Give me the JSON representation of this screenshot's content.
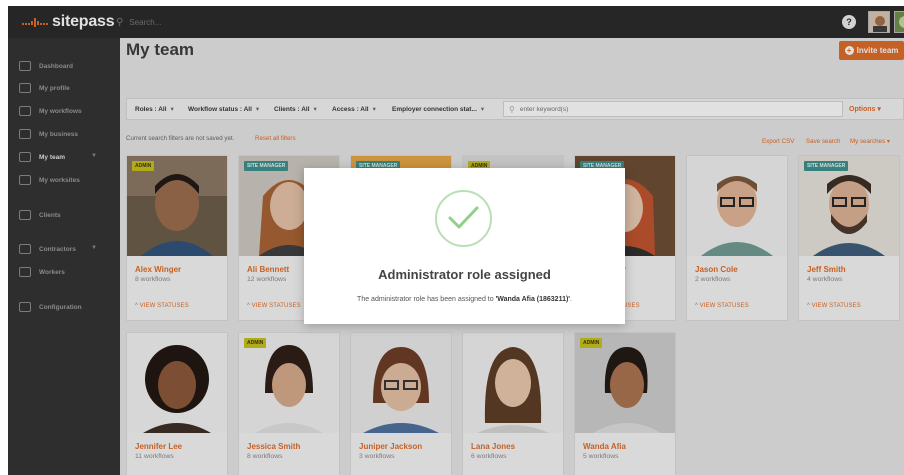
{
  "app": {
    "brand": "sitepass"
  },
  "topbar": {
    "search_placeholder": "Search...",
    "help": "?"
  },
  "sidebar": {
    "items": [
      {
        "label": "Dashboard"
      },
      {
        "label": "My profile"
      },
      {
        "label": "My workflows"
      },
      {
        "label": "My business"
      },
      {
        "label": "My team",
        "active": true,
        "expandable": true
      },
      {
        "label": "My worksites"
      },
      {
        "label": "Clients"
      },
      {
        "label": "Contractors",
        "expandable": true
      },
      {
        "label": "Workers"
      },
      {
        "label": "Configuration"
      }
    ]
  },
  "page": {
    "title": "My team",
    "invite_label": "Invite team",
    "accent": "#e06b25"
  },
  "filters": {
    "roles": "Roles : All",
    "workflow_status": "Workflow status : All",
    "clients": "Clients : All",
    "access": "Access : All",
    "employer": "Employer connection stat...",
    "keyword_placeholder": "enter keyword(s)",
    "options_label": "Options",
    "note": "Current search filters are not saved yet.",
    "reset_label": "Reset all filters",
    "export_label": "Export CSV",
    "save_label": "Save search",
    "my_searches_label": "My searches"
  },
  "team": [
    {
      "name": "Alex Winger",
      "workflows": "8 workflows",
      "badge": "ADMIN",
      "status_link": "^ VIEW STATUSES"
    },
    {
      "name": "Ali Bennett",
      "workflows": "12 workflows",
      "badge": "SITE MANAGER",
      "status_link": "^ VIEW STATUSES"
    },
    {
      "name": "",
      "workflows": "",
      "badge": "SITE MANAGER",
      "status_link": ""
    },
    {
      "name": "",
      "workflows": "",
      "badge": "ADMIN",
      "status_link": ""
    },
    {
      "name": "r",
      "workflows": "",
      "badge": "SITE MANAGER",
      "status_link": "USES"
    },
    {
      "name": "Jason Cole",
      "workflows": "2 workflows",
      "badge": "",
      "status_link": "^ VIEW STATUSES"
    },
    {
      "name": "Jeff Smith",
      "workflows": "4 workflows",
      "badge": "SITE MANAGER",
      "status_link": "^ VIEW STATUSES"
    },
    {
      "name": "Jennifer Lee",
      "workflows": "11 workflows",
      "badge": "",
      "status_link": ""
    },
    {
      "name": "Jessica Smith",
      "workflows": "8 workflows",
      "badge": "ADMIN",
      "status_link": ""
    },
    {
      "name": "Juniper Jackson",
      "workflows": "3 workflows",
      "badge": "",
      "status_link": ""
    },
    {
      "name": "Lana Jones",
      "workflows": "6 workflows",
      "badge": "",
      "status_link": ""
    },
    {
      "name": "Wanda Afia",
      "workflows": "5 workflows",
      "badge": "ADMIN",
      "status_link": ""
    }
  ],
  "modal": {
    "title": "Administrator role assigned",
    "message_prefix": "The administrator role has been assigned to ",
    "message_target": "'Wanda Afia (1863211)'",
    "message_suffix": ".",
    "success_color": "#8fd08a"
  }
}
